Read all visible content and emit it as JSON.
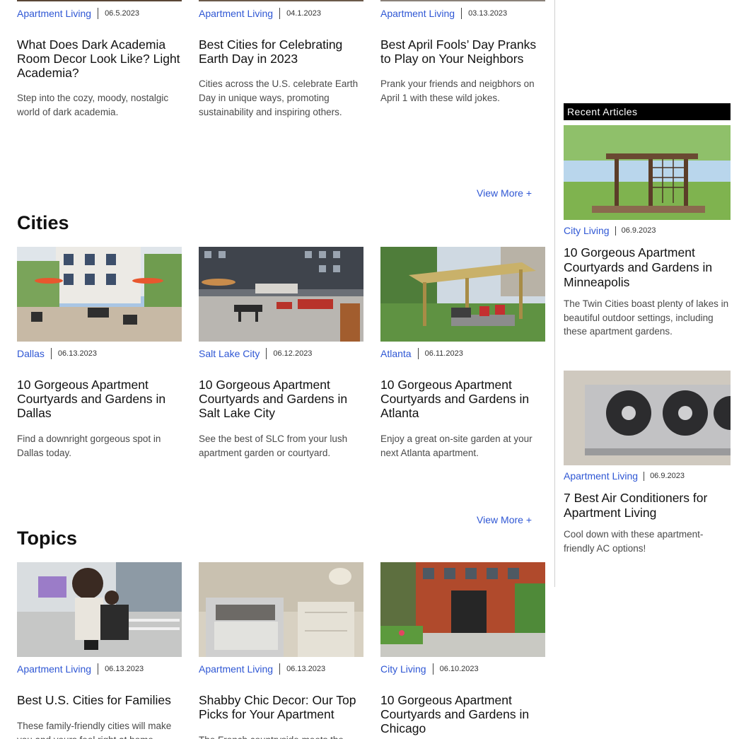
{
  "featured": [
    {
      "category": "Apartment Living",
      "date": "06.5.2023",
      "title": "What Does Dark Academia Room Decor Look Like? Light Academia?",
      "excerpt": "Step into the cozy, moody, nostalgic world of dark academia."
    },
    {
      "category": "Apartment Living",
      "date": "04.1.2023",
      "title": "Best Cities for Celebrating Earth Day in 2023",
      "excerpt": "Cities across the U.S. celebrate Earth Day in unique ways, promoting sustainability and inspiring others."
    },
    {
      "category": "Apartment Living",
      "date": "03.13.2023",
      "title": "Best April Fools’ Day Pranks to Play on Your Neighbors",
      "excerpt": "Prank your friends and neigbhors on April 1 with these wild jokes."
    }
  ],
  "view_more_label": "View More +",
  "cities": {
    "heading": "Cities",
    "items": [
      {
        "category": "Dallas",
        "date": "06.13.2023",
        "title": "10 Gorgeous Apartment Courtyards and Gardens in Dallas",
        "excerpt": "Find a downright gorgeous spot in Dallas today."
      },
      {
        "category": "Salt Lake City",
        "date": "06.12.2023",
        "title": "10 Gorgeous Apartment Courtyards and Gardens in Salt Lake City",
        "excerpt": "See the best of SLC from your lush apartment garden or courtyard."
      },
      {
        "category": "Atlanta",
        "date": "06.11.2023",
        "title": "10 Gorgeous Apartment Courtyards and Gardens in Atlanta",
        "excerpt": "Enjoy a great on-site garden at your next Atlanta apartment."
      }
    ]
  },
  "topics": {
    "heading": "Topics",
    "items": [
      {
        "category": "Apartment Living",
        "date": "06.13.2023",
        "title": "Best U.S. Cities for Families",
        "excerpt": "These family-friendly cities will make you and yours feel right at home."
      },
      {
        "category": "Apartment Living",
        "date": "06.13.2023",
        "title": "Shabby Chic Decor: Our Top Picks for Your Apartment",
        "excerpt": "The French countryside meets the"
      },
      {
        "category": "City Living",
        "date": "06.10.2023",
        "title": "10 Gorgeous Apartment Courtyards and Gardens in Chicago",
        "excerpt": ""
      }
    ]
  },
  "sidebar": {
    "heading": "Recent Articles",
    "items": [
      {
        "category": "City Living",
        "date": "06.9.2023",
        "title": "10 Gorgeous Apartment Courtyards and Gardens in Minneapolis",
        "excerpt": "The Twin Cities boast plenty of lakes in beautiful outdoor settings, including these apartment gardens."
      },
      {
        "category": "Apartment Living",
        "date": "06.9.2023",
        "title": "7 Best Air Conditioners for Apartment Living",
        "excerpt": "Cool down with these apartment-friendly AC options!"
      }
    ]
  },
  "colors": {
    "link": "#2f57d4",
    "sidebar_head_bg": "#000000"
  }
}
